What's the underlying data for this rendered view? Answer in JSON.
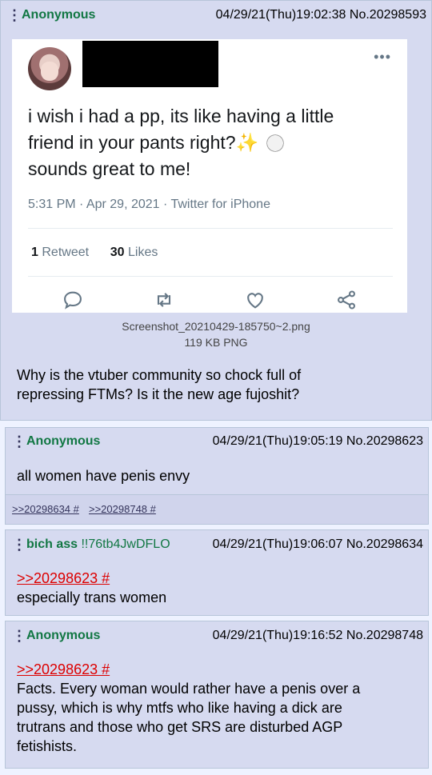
{
  "posts": [
    {
      "name": "Anonymous",
      "datetime": "04/29/21(Thu)19:02:38",
      "number": "No.20298593",
      "tweet": {
        "text_line1": "i wish i had a pp, its like having a little",
        "text_line2": "friend in your pants right?",
        "text_line3": "sounds great to me!",
        "sparkle": "✨",
        "meta": "5:31 PM · Apr 29, 2021 · Twitter for iPhone",
        "retweets_count": "1",
        "retweets_label": "Retweet",
        "likes_count": "30",
        "likes_label": "Likes",
        "more": "•••"
      },
      "file_name": "Screenshot_20210429-185750~2.png",
      "file_size": "119 KB PNG",
      "comment_line1": "Why is the vtuber community so chock full of",
      "comment_line2": "repressing FTMs? Is it the new age fujoshit?"
    },
    {
      "name": "Anonymous",
      "datetime": "04/29/21(Thu)19:05:19",
      "number": "No.20298623",
      "comment": "all women have penis envy",
      "backlinks": [
        ">>20298634 #",
        ">>20298748 #"
      ]
    },
    {
      "name": "bich ass",
      "tripcode": "!!76tb4JwDFLO",
      "datetime": "04/29/21(Thu)19:06:07",
      "number": "No.20298634",
      "quote": ">>20298623 #",
      "comment": "especially trans women"
    },
    {
      "name": "Anonymous",
      "datetime": "04/29/21(Thu)19:16:52",
      "number": "No.20298748",
      "quote": ">>20298623 #",
      "comment_lines": [
        "Facts. Every woman would rather have a penis over a",
        "pussy, which is why mtfs who like having a dick are",
        "trutrans and those who get SRS are disturbed AGP",
        "fetishists."
      ]
    }
  ],
  "menu_glyph": "⋮",
  "colors": {
    "name": "#117743",
    "quote": "#dd0000",
    "post_bg": "#d6daf0",
    "page_bg": "#eef2ff"
  }
}
